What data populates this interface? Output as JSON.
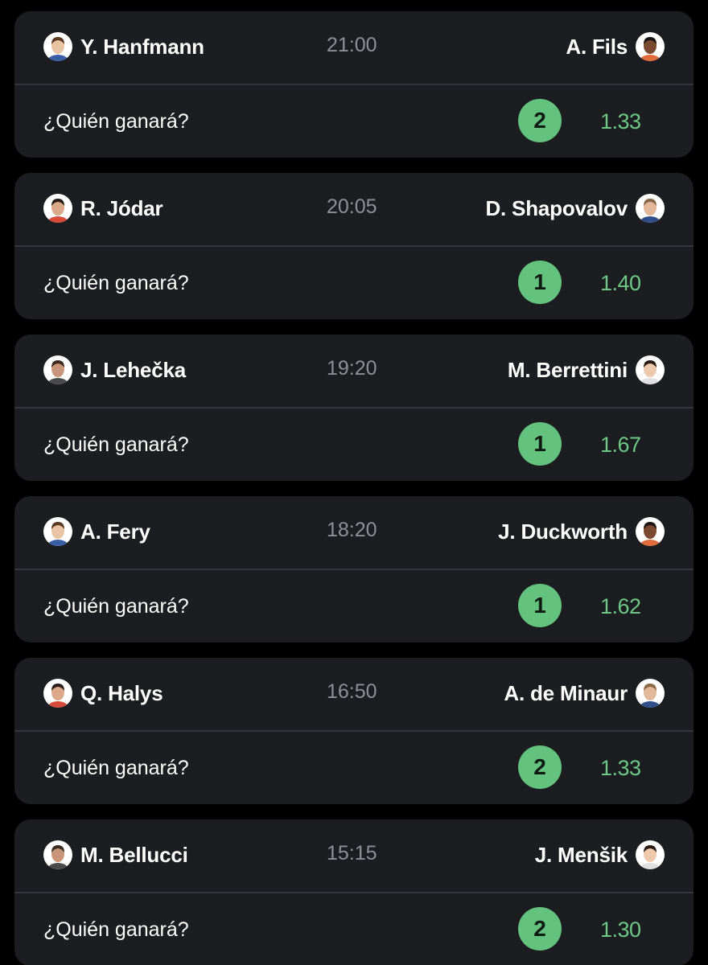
{
  "colors": {
    "background": "#000000",
    "card": "#1c1d20",
    "divider": "#33353a",
    "pick_circle": "#63c27e",
    "odds_text": "#6cc884",
    "time_text": "#8e9096"
  },
  "matches": [
    {
      "player1": "Y. Hanfmann",
      "time": "21:00",
      "player2": "A. Fils",
      "question": "¿Quién ganará?",
      "pick": "2",
      "odds": "1.33",
      "player1_avatar_icon": "player-photo-icon",
      "player2_avatar_icon": "player-photo-icon"
    },
    {
      "player1": "R. Jódar",
      "time": "20:05",
      "player2": "D. Shapovalov",
      "question": "¿Quién ganará?",
      "pick": "1",
      "odds": "1.40",
      "player1_avatar_icon": "player-photo-icon",
      "player2_avatar_icon": "player-photo-icon"
    },
    {
      "player1": "J. Lehečka",
      "time": "19:20",
      "player2": "M. Berrettini",
      "question": "¿Quién ganará?",
      "pick": "1",
      "odds": "1.67",
      "player1_avatar_icon": "player-photo-icon",
      "player2_avatar_icon": "player-photo-icon"
    },
    {
      "player1": "A. Fery",
      "time": "18:20",
      "player2": "J. Duckworth",
      "question": "¿Quién ganará?",
      "pick": "1",
      "odds": "1.62",
      "player1_avatar_icon": "player-photo-icon",
      "player2_avatar_icon": "player-photo-icon"
    },
    {
      "player1": "Q. Halys",
      "time": "16:50",
      "player2": "A. de Minaur",
      "question": "¿Quién ganará?",
      "pick": "2",
      "odds": "1.33",
      "player1_avatar_icon": "player-photo-icon",
      "player2_avatar_icon": "player-photo-icon"
    },
    {
      "player1": "M. Bellucci",
      "time": "15:15",
      "player2": "J. Menšik",
      "question": "¿Quién ganará?",
      "pick": "2",
      "odds": "1.30",
      "player1_avatar_icon": "player-photo-icon",
      "player2_avatar_icon": "player-photo-icon"
    }
  ]
}
